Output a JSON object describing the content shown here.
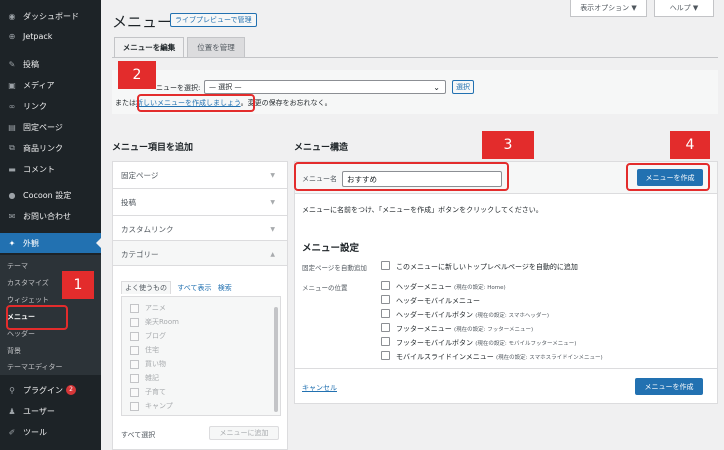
{
  "sidebar": {
    "items": [
      {
        "label": "ダッシュボード",
        "icon": "dashboard-icon",
        "glyph": "◉"
      },
      {
        "label": "Jetpack",
        "icon": "jetpack-icon",
        "glyph": "⊕"
      },
      {
        "label": "投稿",
        "icon": "pin-icon",
        "glyph": "✎"
      },
      {
        "label": "メディア",
        "icon": "media-icon",
        "glyph": "▣"
      },
      {
        "label": "リンク",
        "icon": "link-icon",
        "glyph": "∞"
      },
      {
        "label": "固定ページ",
        "icon": "page-icon",
        "glyph": "▤"
      },
      {
        "label": "商品リンク",
        "icon": "product-link-icon",
        "glyph": "⧉"
      },
      {
        "label": "コメント",
        "icon": "comment-icon",
        "glyph": "▬"
      },
      {
        "label": "Cocoon 設定",
        "icon": "cocoon-icon",
        "glyph": "●"
      },
      {
        "label": "お問い合わせ",
        "icon": "mail-icon",
        "glyph": "✉"
      },
      {
        "label": "外観",
        "icon": "appearance-icon",
        "glyph": "✦"
      },
      {
        "label": "プラグイン",
        "icon": "plugin-icon",
        "glyph": "⚲",
        "badge": "2"
      },
      {
        "label": "ユーザー",
        "icon": "user-icon",
        "glyph": "♟"
      },
      {
        "label": "ツール",
        "icon": "tool-icon",
        "glyph": "✐"
      }
    ],
    "submenu": [
      "テーマ",
      "カスタマイズ",
      "ウィジェット",
      "メニュー",
      "ヘッダー",
      "背景",
      "テーマエディター"
    ]
  },
  "topbar": {
    "screen_options": "表示オプション ▼",
    "help": "ヘルプ ▼"
  },
  "page": {
    "title": "メニュー",
    "live_preview": "ライブプレビューで管理"
  },
  "tabs": {
    "edit": "メニューを編集",
    "locations": "位置を管理"
  },
  "select_menu": {
    "label": "ニューを選択:",
    "value": "— 選択 —",
    "button": "選択",
    "or_text": "または",
    "create_link": "新しいメニューを作成しましょう",
    "after_text": "。変更の保存をお忘れなく。"
  },
  "add_items": {
    "heading": "メニュー項目を追加",
    "sections": [
      "固定ページ",
      "投稿",
      "カスタムリンク",
      "カテゴリー"
    ],
    "cat_tabs": [
      "よく使うもの",
      "すべて表示",
      "検索"
    ],
    "categories": [
      "アニメ",
      "楽天Room",
      "ブログ",
      "住宅",
      "買い物",
      "雑記",
      "子育て",
      "キャンプ"
    ],
    "select_all": "すべて選択",
    "add_button": "メニューに追加"
  },
  "structure": {
    "heading": "メニュー構造",
    "name_label": "メニュー名",
    "name_value": "おすすめ",
    "create_button": "メニューを作成",
    "hint": "メニューに名前をつけ、「メニューを作成」ボタンをクリックしてください。",
    "settings_heading": "メニュー設定",
    "auto_add_label": "固定ページを自動追加",
    "auto_add_option": "このメニューに新しいトップレベルページを自動的に追加",
    "location_label": "メニューの位置",
    "locations": [
      {
        "name": "ヘッダーメニュー",
        "note": "(現在の設定: Home)"
      },
      {
        "name": "ヘッダーモバイルメニュー",
        "note": ""
      },
      {
        "name": "ヘッダーモバイルボタン",
        "note": "(現在の設定: スマホヘッダー)"
      },
      {
        "name": "フッターメニュー",
        "note": "(現在の設定: フッターメニュー)"
      },
      {
        "name": "フッターモバイルボタン",
        "note": "(現在の設定: モバイルフッターメニュー)"
      },
      {
        "name": "モバイルスライドインメニュー",
        "note": "(現在の設定: スマホスライドインメニュー)"
      }
    ],
    "cancel": "キャンセル",
    "create_button_bottom": "メニューを作成"
  },
  "annotations": [
    "1",
    "2",
    "3",
    "4"
  ],
  "colors": {
    "accent": "#2271b1",
    "highlight": "#e32c2c",
    "sidebar": "#1d2327"
  }
}
